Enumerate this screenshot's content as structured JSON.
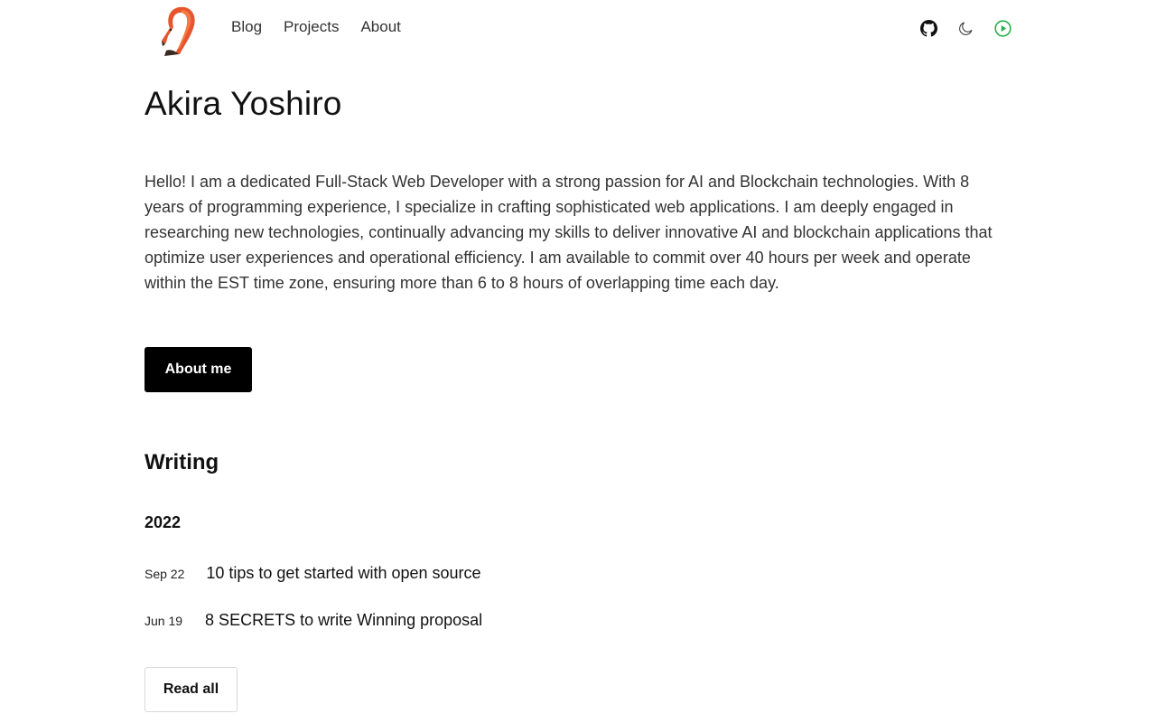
{
  "header": {
    "logo_name": "flamingo-logo",
    "nav": [
      {
        "label": "Blog"
      },
      {
        "label": "Projects"
      },
      {
        "label": "About"
      }
    ],
    "icons": [
      "github-icon",
      "moon-icon",
      "play-circle-icon"
    ],
    "accent_color": "#22b14c"
  },
  "hero": {
    "name": "Akira Yoshiro",
    "intro": "Hello! I am a dedicated Full-Stack Web Developer with a strong passion for AI and Blockchain technologies. With 8 years of programming experience, I specialize in crafting sophisticated web applications. I am deeply engaged in researching new technologies, continually advancing my skills to deliver innovative AI and blockchain applications that optimize user experiences and operational efficiency. I am available to commit over 40 hours per week and operate within the EST time zone, ensuring more than 6 to 8 hours of overlapping time each day.",
    "about_button": "About me"
  },
  "writing": {
    "title": "Writing",
    "groups": [
      {
        "year": "2022",
        "posts": [
          {
            "date": "Sep 22",
            "title": "10 tips to get started with open source"
          },
          {
            "date": "Jun 19",
            "title": "8 SECRETS to write Winning proposal"
          }
        ]
      }
    ],
    "read_all_button": "Read all"
  }
}
